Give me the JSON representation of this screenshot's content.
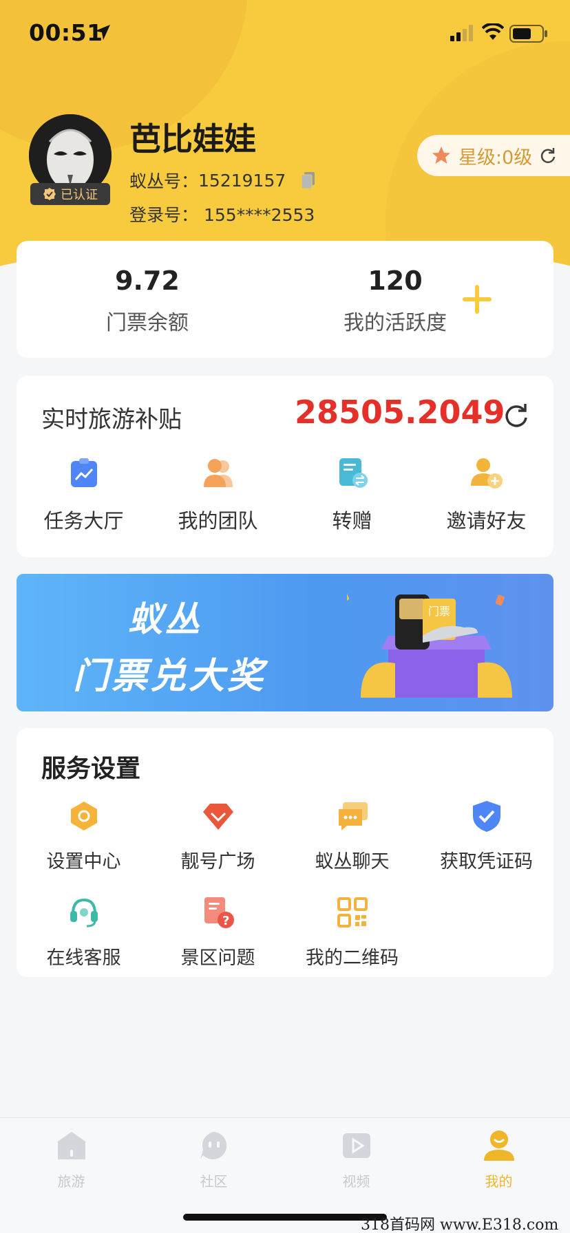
{
  "status_bar": {
    "time": "00:51"
  },
  "profile": {
    "name": "芭比娃娃",
    "verified_label": "已认证",
    "id_label": "蚁丛号：",
    "id_value": "15219157",
    "login_label": "登录号：",
    "login_value": "155****2553",
    "star_level": "星级:0级"
  },
  "stats": [
    {
      "value": "9.72",
      "label": "门票余额"
    },
    {
      "value": "120",
      "label": "我的活跃度"
    }
  ],
  "subsidy": {
    "title": "实时旅游补贴",
    "value": "28505.2049"
  },
  "actions": [
    {
      "label": "任务大厅",
      "icon": "task-chart-icon",
      "color": "#4f86f7"
    },
    {
      "label": "我的团队",
      "icon": "team-icon",
      "color": "#f5a25b"
    },
    {
      "label": "转赠",
      "icon": "transfer-icon",
      "color": "#4ab9d8"
    },
    {
      "label": "邀请好友",
      "icon": "invite-user-icon",
      "color": "#f3b43c"
    }
  ],
  "banner": {
    "brand": "蚁丛",
    "slogan": "门票兑大奖",
    "ticket_text": "门票"
  },
  "services": {
    "title": "服务设置",
    "items": [
      {
        "label": "设置中心",
        "icon": "settings-hexagon-icon",
        "color": "#f5b33a"
      },
      {
        "label": "靓号广场",
        "icon": "diamond-icon",
        "color": "#e9583a"
      },
      {
        "label": "蚁丛聊天",
        "icon": "chat-icon",
        "color": "#f4b13d"
      },
      {
        "label": "获取凭证码",
        "icon": "shield-check-icon",
        "color": "#4f86f7"
      },
      {
        "label": "在线客服",
        "icon": "headset-icon",
        "color": "#3fb8a8"
      },
      {
        "label": "景区问题",
        "icon": "doc-question-icon",
        "color": "#ec5648"
      },
      {
        "label": "我的二维码",
        "icon": "qr-code-icon",
        "color": "#f4b13d"
      }
    ]
  },
  "tabs": [
    {
      "label": "旅游",
      "icon": "home-icon",
      "active": false
    },
    {
      "label": "社区",
      "icon": "community-icon",
      "active": false
    },
    {
      "label": "视频",
      "icon": "video-icon",
      "active": false
    },
    {
      "label": "我的",
      "icon": "profile-icon",
      "active": true
    }
  ],
  "colors": {
    "header_yellow": "#f8cb3e",
    "subsidy_red": "#e5302a",
    "tab_active": "#f0b62a"
  },
  "watermark": "318首码网 www.E318.com"
}
